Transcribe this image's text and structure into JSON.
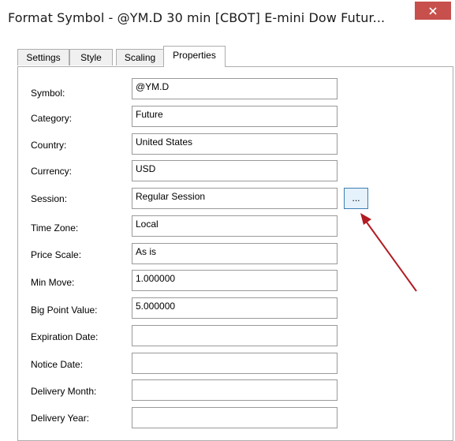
{
  "window": {
    "title": "Format Symbol - @YM.D 30 min [CBOT] E-mini Dow Futur..."
  },
  "tabs": [
    {
      "label": "Settings"
    },
    {
      "label": "Style"
    },
    {
      "label": "Scaling"
    },
    {
      "label": "Properties"
    }
  ],
  "fields": [
    {
      "label": "Symbol:",
      "value": "@YM.D"
    },
    {
      "label": "Category:",
      "value": "Future"
    },
    {
      "label": "Country:",
      "value": "United States"
    },
    {
      "label": "Currency:",
      "value": "USD"
    },
    {
      "label": "Session:",
      "value": "Regular Session"
    },
    {
      "label": "Time Zone:",
      "value": "Local"
    },
    {
      "label": "Price Scale:",
      "value": "As is"
    },
    {
      "label": "Min Move:",
      "value": "1.000000"
    },
    {
      "label": "Big Point Value:",
      "value": "5.000000"
    },
    {
      "label": "Expiration Date:",
      "value": ""
    },
    {
      "label": "Notice Date:",
      "value": ""
    },
    {
      "label": "Delivery Month:",
      "value": ""
    },
    {
      "label": "Delivery Year:",
      "value": ""
    }
  ],
  "session_button": {
    "label": "..."
  },
  "colors": {
    "close_button": "#c7504d",
    "annotation_arrow": "#b01c22",
    "ellipsis_button_border": "#3c7fb1",
    "ellipsis_button_fill": "#e5f1fb"
  },
  "icons": {
    "close": "close-icon"
  }
}
